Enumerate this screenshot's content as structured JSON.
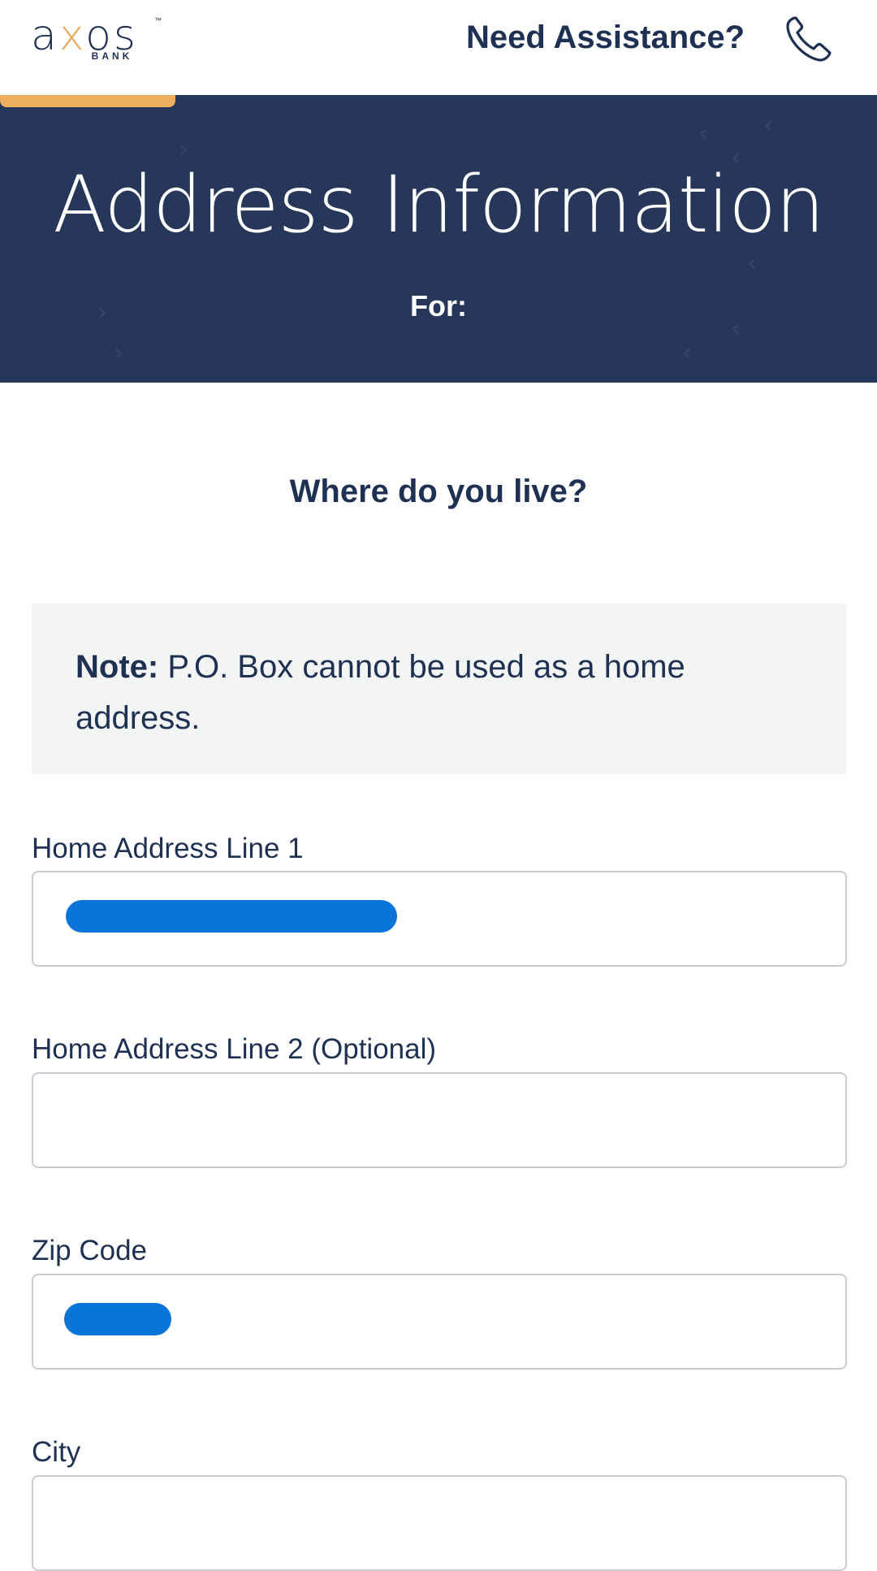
{
  "header": {
    "brand": "axos",
    "brand_sub": "BANK",
    "trademark": "™",
    "assist_label": "Need Assistance?",
    "phone_icon": "phone-icon"
  },
  "banner": {
    "title": "Address Information",
    "subtitle": "For:"
  },
  "main": {
    "question": "Where do you live?",
    "note_label": "Note:",
    "note_text": " P.O. Box cannot be used as a home address.",
    "fields": [
      {
        "label": "Home Address Line 1",
        "value_redacted": true
      },
      {
        "label": "Home Address Line 2 (Optional)",
        "value_redacted": false
      },
      {
        "label": "Zip Code",
        "value_redacted": true
      },
      {
        "label": "City",
        "value_redacted": false
      }
    ]
  },
  "colors": {
    "navy": "#26375a",
    "text": "#1f3152",
    "accent": "#eeae5f",
    "redaction": "#0a75d8"
  }
}
